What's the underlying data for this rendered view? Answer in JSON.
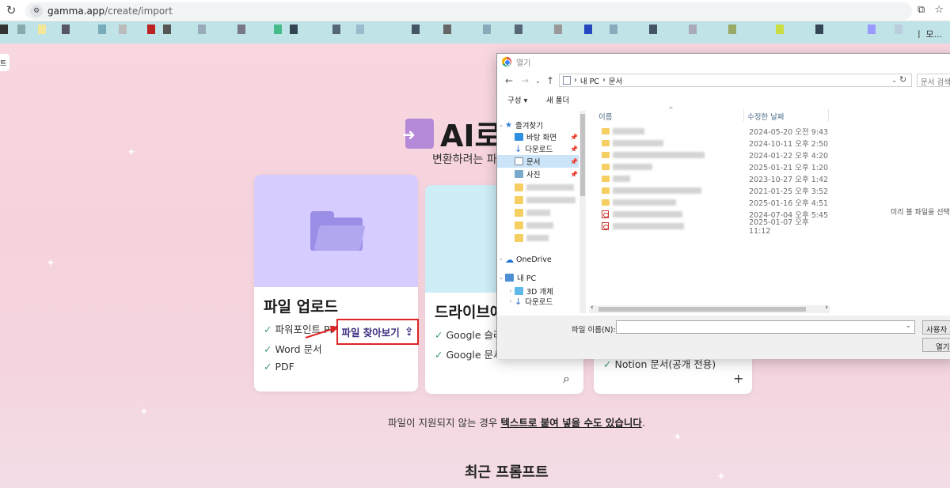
{
  "browser": {
    "url_host": "gamma.app",
    "url_path": "/create/import",
    "reload_icon": "reload-icon",
    "bookmarks_more": "ㅣ 모..."
  },
  "page": {
    "side_tab_text": "트",
    "hero_title": "AI로",
    "hero_sub": "변환하려는 파",
    "cards": [
      {
        "title": "파일 업로드",
        "features": [
          "파워포인트 PPT/X",
          "Word 문서",
          "PDF"
        ],
        "action_label": "파일 찾아보기",
        "action_icon": "upload-icon"
      },
      {
        "title": "드라이브에",
        "features": [
          "Google 슬라",
          "Google 문서"
        ],
        "action_icon": "search-icon"
      },
      {
        "title": "",
        "features": [
          "Notion 문서(공개 전용)"
        ],
        "action_icon": "plus-icon"
      }
    ],
    "note_prefix": "파일이 지원되지 않는 경우 ",
    "note_link": "텍스트로 붙여 넣을 수도 있습니다",
    "note_suffix": ".",
    "recent_title": "최근 프롬프트"
  },
  "dialog": {
    "title": "열기",
    "path": [
      "내 PC",
      "문서"
    ],
    "search_placeholder": "문서 검색",
    "toolbar": {
      "organize": "구성 ▾",
      "new_folder": "새 폴더"
    },
    "tree": [
      {
        "label": "즐겨찾기",
        "icon": "star-icon",
        "pinned": false
      },
      {
        "label": "바탕 화면",
        "icon": "desktop-icon",
        "pinned": true
      },
      {
        "label": "다운로드",
        "icon": "download-icon",
        "pinned": true
      },
      {
        "label": "문서",
        "icon": "document-icon",
        "pinned": true,
        "selected": true
      },
      {
        "label": "사진",
        "icon": "picture-icon",
        "pinned": true
      },
      {
        "label": "OneDrive",
        "icon": "onedrive-icon"
      },
      {
        "label": "내 PC",
        "icon": "computer-icon"
      },
      {
        "label": "3D 개체",
        "icon": "cube-icon"
      },
      {
        "label": "다운로드",
        "icon": "download-icon"
      }
    ],
    "columns": {
      "name": "이름",
      "modified": "수정한 날짜"
    },
    "files": [
      {
        "type": "folder",
        "modified": "2024-05-20 오전 9:43"
      },
      {
        "type": "folder",
        "modified": "2024-10-11 오후 2:50"
      },
      {
        "type": "folder",
        "modified": "2024-01-22 오후 4:20"
      },
      {
        "type": "folder",
        "modified": "2025-01-21 오후 1:20"
      },
      {
        "type": "folder",
        "modified": "2023-10-27 오후 1:42"
      },
      {
        "type": "folder",
        "modified": "2021-01-25 오후 3:52"
      },
      {
        "type": "folder",
        "modified": "2025-01-16 오후 4:51"
      },
      {
        "type": "pdf",
        "modified": "2024-07-04 오후 5:45"
      },
      {
        "type": "pdf",
        "modified": "2025-01-07 오후 11:12"
      }
    ],
    "preview_msg": "미리 볼 파일을 선택",
    "filename_label": "파일 이름(N):",
    "filter_label": "사용자 지정",
    "open_label": "열기(O)"
  }
}
